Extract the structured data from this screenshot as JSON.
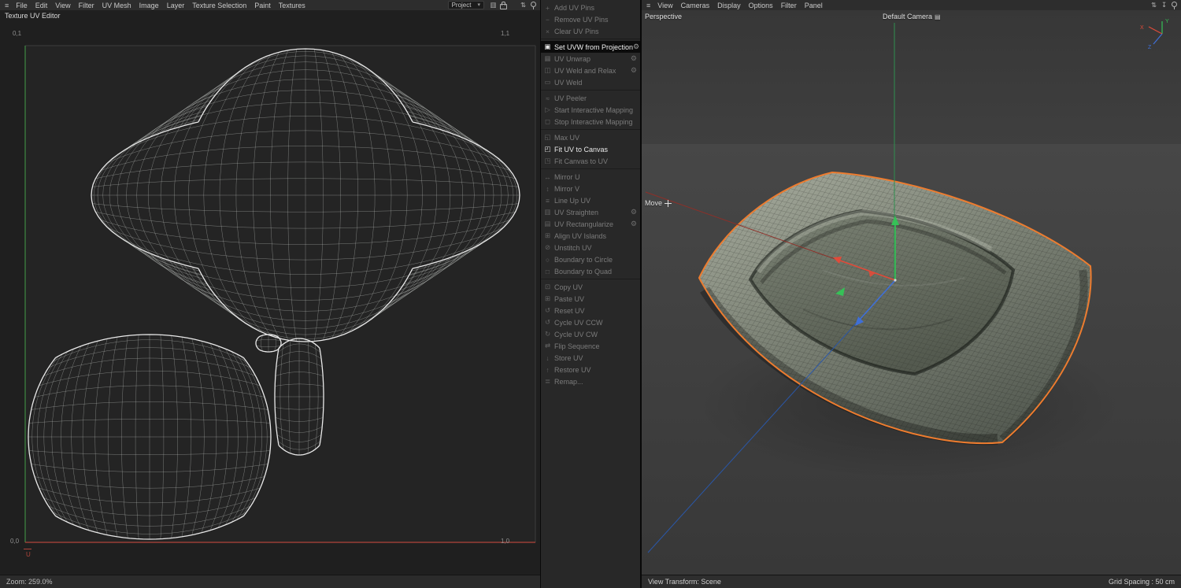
{
  "colors": {
    "selection_orange": "#ed7c2f",
    "axis_x_red": "#e04b3a",
    "axis_y_green": "#36c157",
    "axis_z_blue": "#3f6fd6",
    "uv_u_red": "#b0443a",
    "uv_v_green": "#3f8a44"
  },
  "icons": {
    "hamburger": "≡",
    "dropdown_caret": "▾",
    "gear": "⚙",
    "camera_tag": "▤"
  },
  "icon_defs": {
    "chart-icon": {
      "glyph": "▥"
    },
    "lock-icon": {
      "shape": "lock"
    },
    "updown-arrows-icon": {
      "glyph": "⇅"
    },
    "down-arrow-icon": {
      "glyph": "↧"
    },
    "pin-icon": {
      "shape": "pin"
    }
  },
  "left_panel": {
    "menu": [
      "File",
      "Edit",
      "View",
      "Filter",
      "UV Mesh",
      "Image",
      "Layer",
      "Texture Selection",
      "Paint",
      "Textures"
    ],
    "header_icons": [
      "chart-icon",
      "lock-icon",
      "gap",
      "updown-arrows-icon",
      "pin-icon"
    ],
    "title": "Texture UV Editor",
    "project_dropdown": {
      "value": "Project"
    },
    "uv_canvas": {
      "corner_top_left": "0,1",
      "corner_top_right": "1,1",
      "corner_bottom_left": "0,0",
      "corner_bottom_right": "1,0",
      "u_axis_label": "U"
    },
    "status": {
      "zoom": "Zoom: 259.0%"
    }
  },
  "uv_commands": [
    {
      "label": "Add UV Pins",
      "icon": "add-uv-pins-icon",
      "glyph": "+",
      "state": "disabled"
    },
    {
      "label": "Remove UV Pins",
      "icon": "remove-uv-pins-icon",
      "glyph": "−",
      "state": "disabled"
    },
    {
      "label": "Clear UV Pins",
      "icon": "clear-uv-pins-icon",
      "glyph": "×",
      "state": "disabled"
    },
    {
      "separator": true
    },
    {
      "label": "Set UVW from Projection",
      "icon": "set-uvw-from-projection-icon",
      "glyph": "▣",
      "state": "selected",
      "gear": true
    },
    {
      "label": "UV Unwrap",
      "icon": "uv-unwrap-icon",
      "glyph": "▦",
      "state": "disabled",
      "gear": true
    },
    {
      "label": "UV Weld and Relax",
      "icon": "uv-weld-and-relax-icon",
      "glyph": "◫",
      "state": "disabled",
      "gear": true
    },
    {
      "label": "UV Weld",
      "icon": "uv-weld-icon",
      "glyph": "▭",
      "state": "disabled"
    },
    {
      "separator": true
    },
    {
      "label": "UV Peeler",
      "icon": "uv-peeler-icon",
      "glyph": "≈",
      "state": "disabled"
    },
    {
      "label": "Start Interactive Mapping",
      "icon": "start-interactive-mapping-icon",
      "glyph": "▷",
      "state": "disabled"
    },
    {
      "label": "Stop Interactive Mapping",
      "icon": "stop-interactive-mapping-icon",
      "glyph": "◻",
      "state": "disabled"
    },
    {
      "separator": true
    },
    {
      "label": "Max UV",
      "icon": "max-uv-icon",
      "glyph": "◱",
      "state": "disabled"
    },
    {
      "label": "Fit UV to Canvas",
      "icon": "fit-uv-to-canvas-icon",
      "glyph": "◰",
      "state": "enabled"
    },
    {
      "label": "Fit Canvas to UV",
      "icon": "fit-canvas-to-uv-icon",
      "glyph": "◳",
      "state": "disabled"
    },
    {
      "separator": true
    },
    {
      "label": "Mirror U",
      "icon": "mirror-u-icon",
      "glyph": "↔",
      "state": "disabled"
    },
    {
      "label": "Mirror V",
      "icon": "mirror-v-icon",
      "glyph": "↕",
      "state": "disabled"
    },
    {
      "label": "Line Up UV",
      "icon": "line-up-uv-icon",
      "glyph": "≡",
      "state": "disabled"
    },
    {
      "label": "UV Straighten",
      "icon": "uv-straighten-icon",
      "glyph": "▥",
      "state": "disabled",
      "gear": true
    },
    {
      "label": "UV Rectangularize",
      "icon": "uv-rectangularize-icon",
      "glyph": "▤",
      "state": "disabled",
      "gear": true
    },
    {
      "label": "Align UV Islands",
      "icon": "align-uv-islands-icon",
      "glyph": "⊞",
      "state": "disabled"
    },
    {
      "label": "Unstitch UV",
      "icon": "unstitch-uv-icon",
      "glyph": "⊘",
      "state": "disabled"
    },
    {
      "label": "Boundary to Circle",
      "icon": "boundary-to-circle-icon",
      "glyph": "○",
      "state": "disabled"
    },
    {
      "label": "Boundary to Quad",
      "icon": "boundary-to-quad-icon",
      "glyph": "□",
      "state": "disabled"
    },
    {
      "separator": true
    },
    {
      "label": "Copy UV",
      "icon": "copy-uv-icon",
      "glyph": "⊡",
      "state": "disabled"
    },
    {
      "label": "Paste UV",
      "icon": "paste-uv-icon",
      "glyph": "⊞",
      "state": "disabled"
    },
    {
      "label": "Reset UV",
      "icon": "reset-uv-icon",
      "glyph": "↺",
      "state": "disabled"
    },
    {
      "label": "Cycle UV CCW",
      "icon": "cycle-uv-ccw-icon",
      "glyph": "↺",
      "state": "disabled"
    },
    {
      "label": "Cycle UV CW",
      "icon": "cycle-uv-cw-icon",
      "glyph": "↻",
      "state": "disabled"
    },
    {
      "label": "Flip Sequence",
      "icon": "flip-sequence-icon",
      "glyph": "⇄",
      "state": "disabled"
    },
    {
      "label": "Store UV",
      "icon": "store-uv-icon",
      "glyph": "↓",
      "state": "disabled"
    },
    {
      "label": "Restore UV",
      "icon": "restore-uv-icon",
      "glyph": "↑",
      "state": "disabled"
    },
    {
      "label": "Remap...",
      "icon": "remap-icon",
      "glyph": "≣",
      "state": "disabled"
    }
  ],
  "viewport": {
    "menu": [
      "View",
      "Cameras",
      "Display",
      "Options",
      "Filter",
      "Panel"
    ],
    "header_icons": [
      "updown-arrows-icon",
      "down-arrow-icon",
      "pin-icon"
    ],
    "view_label": "Perspective",
    "camera_label": "Default Camera",
    "tool_label": "Move",
    "axis_triad": {
      "x": "X",
      "y": "Y",
      "z": "Z"
    },
    "status": {
      "left": "View Transform: Scene",
      "right": "Grid Spacing : 50 cm"
    }
  }
}
